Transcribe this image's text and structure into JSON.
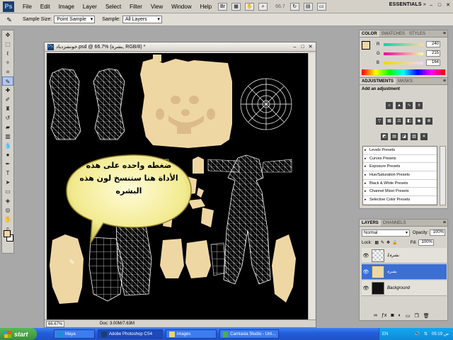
{
  "menubar": {
    "items": [
      "File",
      "Edit",
      "Image",
      "Layer",
      "Select",
      "Filter",
      "View",
      "Window",
      "Help"
    ],
    "zoom": "66.7",
    "workspace": "ESSENTIALS",
    "window_controls": [
      "–",
      "□",
      "✕"
    ]
  },
  "options_bar": {
    "sample_size_label": "Sample Size:",
    "sample_size_value": "Point Sample",
    "sample_label": "Sample:",
    "sample_value": "All Layers"
  },
  "document": {
    "title": "خونشزدباد.psd @ 66.7% (بشرة, RGB/8) *",
    "status_zoom": "66.67%",
    "status_doc": "Doc: 3.00M/7.63M"
  },
  "callout": {
    "lines": [
      "ضغطه واحده على هذه",
      "الأداة هنا ستنسخ لون هذه",
      "البشره"
    ]
  },
  "color_panel": {
    "tabs": [
      "COLOR",
      "SWATCHES",
      "STYLES"
    ],
    "r": "240",
    "g": "215",
    "b": "164",
    "fg_color": "#efd7a4"
  },
  "adjustments_panel": {
    "tabs": [
      "ADJUSTMENTS",
      "MASKS"
    ],
    "heading": "Add an adjustment",
    "presets": [
      "Levels Presets",
      "Curves Presets",
      "Exposure Presets",
      "Hue/Saturation Presets",
      "Black & White Presets",
      "Channel Mixer Presets",
      "Selective Color Presets"
    ]
  },
  "layers_panel": {
    "tabs": [
      "LAYERS",
      "CHANNELS"
    ],
    "blend_mode": "Normal",
    "opacity_label": "Opacity:",
    "opacity": "100%",
    "lock_label": "Lock:",
    "fill_label": "Fill:",
    "fill": "100%",
    "layers": [
      {
        "name": "بشرة1",
        "selected": false
      },
      {
        "name": "بشرة",
        "selected": true
      },
      {
        "name": "Background",
        "selected": false
      }
    ]
  },
  "taskbar": {
    "start": "start",
    "buttons": [
      "Maya",
      "Adobe Photoshop CS4",
      "images",
      "Camtasia Studio - Unt..."
    ],
    "lang": "EN",
    "clock": "05:19 ص"
  }
}
